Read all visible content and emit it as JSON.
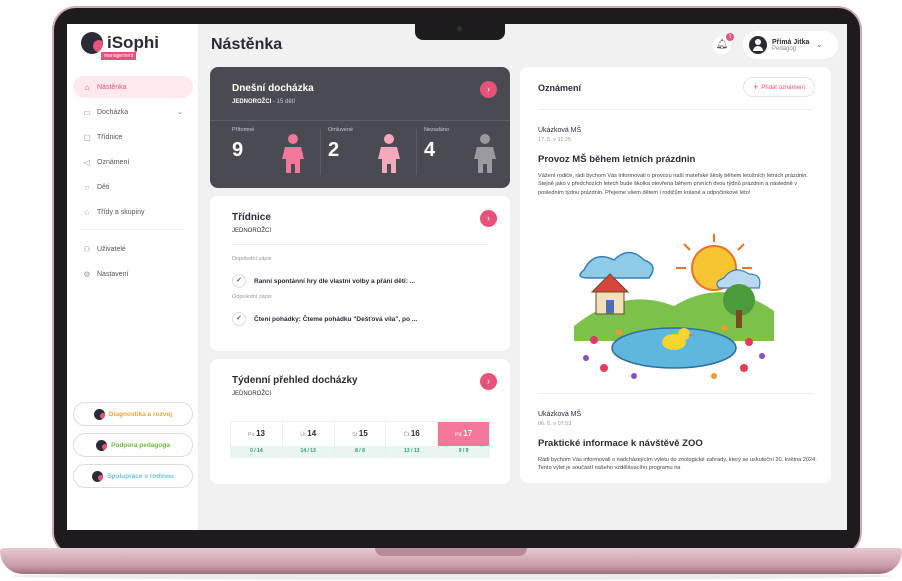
{
  "app": {
    "logo": "iSophi",
    "logo_sub": "management"
  },
  "header": {
    "title": "Nástěnka",
    "notifications_badge": "1",
    "user_name": "Přímá Jitka",
    "user_role": "Pedagog"
  },
  "sidebar": {
    "items": [
      {
        "label": "Nástěnka",
        "icon": "home-icon",
        "active": true
      },
      {
        "label": "Docházka",
        "icon": "calendar-icon"
      },
      {
        "label": "Třídnice",
        "icon": "book-icon"
      },
      {
        "label": "Oznámení",
        "icon": "megaphone-icon"
      },
      {
        "label": "Děti",
        "icon": "child-icon"
      },
      {
        "label": "Třídy a skupiny",
        "icon": "star-icon"
      },
      {
        "label": "Uživatelé",
        "icon": "users-icon"
      },
      {
        "label": "Nastavení",
        "icon": "gear-icon"
      }
    ],
    "pills": [
      {
        "label": "Diagnostika a rozvoj",
        "color": "#f0a53a"
      },
      {
        "label": "Podpora pedagoga",
        "color": "#6dbb3f"
      },
      {
        "label": "Spolupráce s rodinou",
        "color": "#6cc3dd"
      }
    ]
  },
  "attendance": {
    "title": "Dnešní docházka",
    "class": "JEDNOROŽCI",
    "count": "- 15 dětí",
    "stats": [
      {
        "label": "Přítomné",
        "value": "9",
        "color": "#f1789a"
      },
      {
        "label": "Omluvené",
        "value": "2",
        "color": "#f5a9bd"
      },
      {
        "label": "Nezadáno",
        "value": "4",
        "color": "#9a9aa0"
      }
    ]
  },
  "tridnice": {
    "title": "Třídnice",
    "class": "JEDNOROŽCI",
    "entries": [
      {
        "section": "Dopolední zápis",
        "text": "Ranní spontánní hry dle vlastní volby a přání dětí: ..."
      },
      {
        "section": "Odpolední zápis",
        "text": "Čtení pohádky: Čteme pohádku \"Dešťová víla\", po ..."
      }
    ]
  },
  "weekly": {
    "title": "Týdenní přehled docházky",
    "class": "JEDNOROŽCI",
    "days": [
      {
        "name": "Po",
        "date": "13",
        "count": "0 / 14",
        "today": false
      },
      {
        "name": "Út",
        "date": "14",
        "count": "14 / 13",
        "today": false
      },
      {
        "name": "St",
        "date": "15",
        "count": "8 / 8",
        "today": false
      },
      {
        "name": "Čt",
        "date": "16",
        "count": "13 / 13",
        "today": false
      },
      {
        "name": "Pá",
        "date": "17",
        "count": "9 / 9",
        "today": true
      }
    ]
  },
  "announcements": {
    "title": "Oznámení",
    "add_button": "Přidat oznámení",
    "items": [
      {
        "school": "Ukázková MŠ",
        "date": "17. 5. v 11:25",
        "heading": "Provoz MŠ během letních prázdnin",
        "body": "Vážení rodiče, rádi bychom Vás informovali o provozu naší mateřské školy během letošních letních prázdnin. Stejně jako v předchozích letech bude školka otevřena během prvních dvou týdnů prázdnin a následně v posledním týdnu prázdnin. Přejeme všem dětem i rodičům krásné a odpočinkové léto!"
      },
      {
        "school": "Ukázková MŠ",
        "date": "06. 5. v 07:53",
        "heading": "Praktické informace k návštěvě ZOO",
        "body": "Rádi bychom Vás informovali o nadcházejícím výletu do zoologické zahrady, který se uskuteční 20. května 2024. Tento výlet je součástí našeho vzdělávacího programu na"
      }
    ]
  }
}
